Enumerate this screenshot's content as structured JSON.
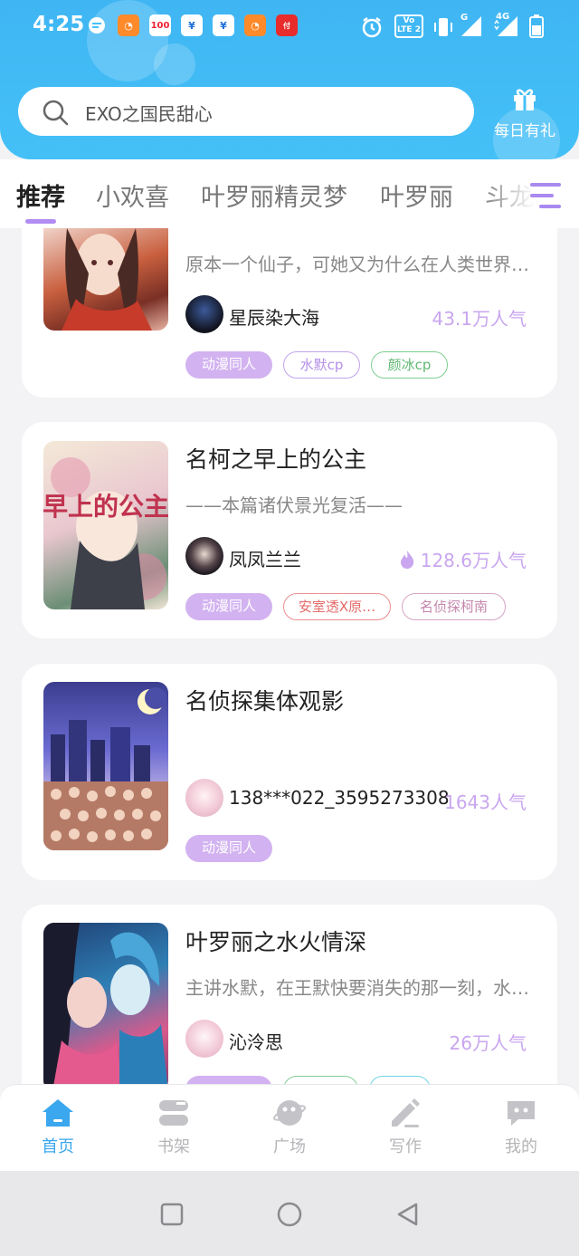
{
  "status_bar": {
    "time": "4:25",
    "app_badges": [
      "100"
    ],
    "indicators": [
      "alarm-icon",
      "volte-icon",
      "vibrate-icon",
      "signal-icon",
      "battery-icon"
    ],
    "network_labels": {
      "volte": "Vo LTE 2",
      "sim1": "G",
      "sim2": "4G"
    }
  },
  "header": {
    "search_text": "EXO之国民甜心",
    "daily_gift_label": "每日有礼",
    "gradient_color": "#42bbf5"
  },
  "tabs": {
    "items": [
      "推荐",
      "小欢喜",
      "叶罗丽精灵梦",
      "叶罗丽",
      "斗龙"
    ],
    "active_index": 0,
    "accent_color": "#b18cf2"
  },
  "books": [
    {
      "title": "",
      "description": "原本一个仙子，可她又为什么在人类世界…",
      "author": "星辰染大海",
      "popularity": "43.1万人气",
      "hot": false,
      "tags": [
        {
          "label": "动漫同人",
          "style": "filled"
        },
        {
          "label": "水默cp",
          "style": "purple"
        },
        {
          "label": "颜冰cp",
          "style": "green"
        }
      ]
    },
    {
      "title": "名柯之早上的公主",
      "description": "——本篇诸伏景光复活——",
      "cover_text": "早上的公主",
      "author": "凤凤兰兰",
      "popularity": "128.6万人气",
      "hot": true,
      "tags": [
        {
          "label": "动漫同人",
          "style": "filled"
        },
        {
          "label": "安室透X原…",
          "style": "red"
        },
        {
          "label": "名侦探柯南",
          "style": "pink"
        }
      ]
    },
    {
      "title": "名侦探集体观影",
      "description": "",
      "author": "138***022_3595273308",
      "popularity": "1643人气",
      "hot": false,
      "tags": [
        {
          "label": "动漫同人",
          "style": "filled"
        }
      ]
    },
    {
      "title": "叶罗丽之水火情深",
      "description": "主讲水默，在王默快要消失的那一刻，水…",
      "author": "沁泠思",
      "popularity": "26万人气",
      "hot": false,
      "tags": [
        {
          "label": "",
          "style": "filled"
        },
        {
          "label": "",
          "style": "green"
        },
        {
          "label": "",
          "style": "cyan"
        }
      ]
    }
  ],
  "bottom_nav": {
    "items": [
      {
        "label": "首页",
        "icon": "home-icon",
        "active": true
      },
      {
        "label": "书架",
        "icon": "bookshelf-icon",
        "active": false
      },
      {
        "label": "广场",
        "icon": "planet-icon",
        "active": false
      },
      {
        "label": "写作",
        "icon": "pen-icon",
        "active": false
      },
      {
        "label": "我的",
        "icon": "chat-face-icon",
        "active": false
      }
    ],
    "active_color": "#3aa7ee"
  },
  "system_nav": {
    "buttons": [
      "recent-apps-icon",
      "home-circle-icon",
      "back-icon"
    ]
  }
}
